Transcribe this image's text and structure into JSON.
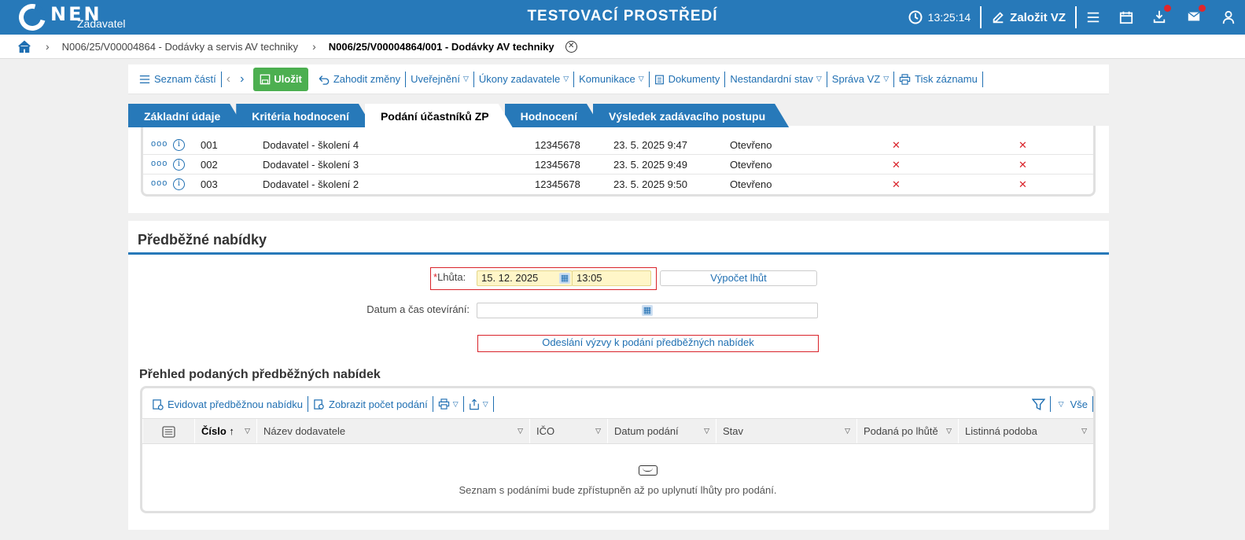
{
  "header": {
    "logo_text": "NEN",
    "logo_sub": "Zadavatel",
    "env_title": "TESTOVACÍ PROSTŘEDÍ",
    "time": "13:25:14",
    "create_label": "Založit VZ"
  },
  "breadcrumb": {
    "items": [
      "N006/25/V00004864 - Dodávky a servis AV techniky",
      "N006/25/V00004864/001 - Dodávky AV techniky"
    ]
  },
  "toolbar": {
    "parts_list": "Seznam částí",
    "save": "Uložit",
    "discard": "Zahodit změny",
    "publish": "Uveřejnění",
    "actions": "Úkony zadavatele",
    "communication": "Komunikace",
    "documents": "Dokumenty",
    "nonstandard": "Nestandardní stav",
    "admin": "Správa VZ",
    "print": "Tisk záznamu"
  },
  "tabs": [
    "Základní údaje",
    "Kritéria hodnocení",
    "Podání účastníků ZP",
    "Hodnocení",
    "Výsledek zadávacího postupu"
  ],
  "submissions": {
    "rows": [
      {
        "no": "001",
        "supplier": "Dodavatel - školení 4",
        "ico": "12345678",
        "date": "23. 5. 2025 9:47",
        "state": "Otevřeno"
      },
      {
        "no": "002",
        "supplier": "Dodavatel - školení 3",
        "ico": "12345678",
        "date": "23. 5. 2025 9:49",
        "state": "Otevřeno"
      },
      {
        "no": "003",
        "supplier": "Dodavatel - školení 2",
        "ico": "12345678",
        "date": "23. 5. 2025 9:50",
        "state": "Otevřeno"
      }
    ],
    "late_mark": "✕",
    "paper_mark": "✕"
  },
  "preliminary": {
    "title": "Předběžné nabídky",
    "deadline_label": "Lhůta:",
    "deadline_date": "15. 12. 2025",
    "deadline_time": "13:05",
    "calc_button": "Výpočet lhůt",
    "opening_label": "Datum a čas otevírání:",
    "send_button": "Odeslání výzvy k podání předběžných nabídek",
    "overview_title": "Přehled podaných předběžných nabídek",
    "record_btn": "Evidovat předběžnou nabídku",
    "count_btn": "Zobrazit počet podání",
    "all_label": "Vše",
    "columns": [
      "Číslo",
      "Název dodavatele",
      "IČO",
      "Datum podání",
      "Stav",
      "Podaná po lhůtě",
      "Listinná podoba"
    ],
    "empty_message": "Seznam s podáními bude zpřístupněn až po uplynutí lhůty pro podání."
  }
}
